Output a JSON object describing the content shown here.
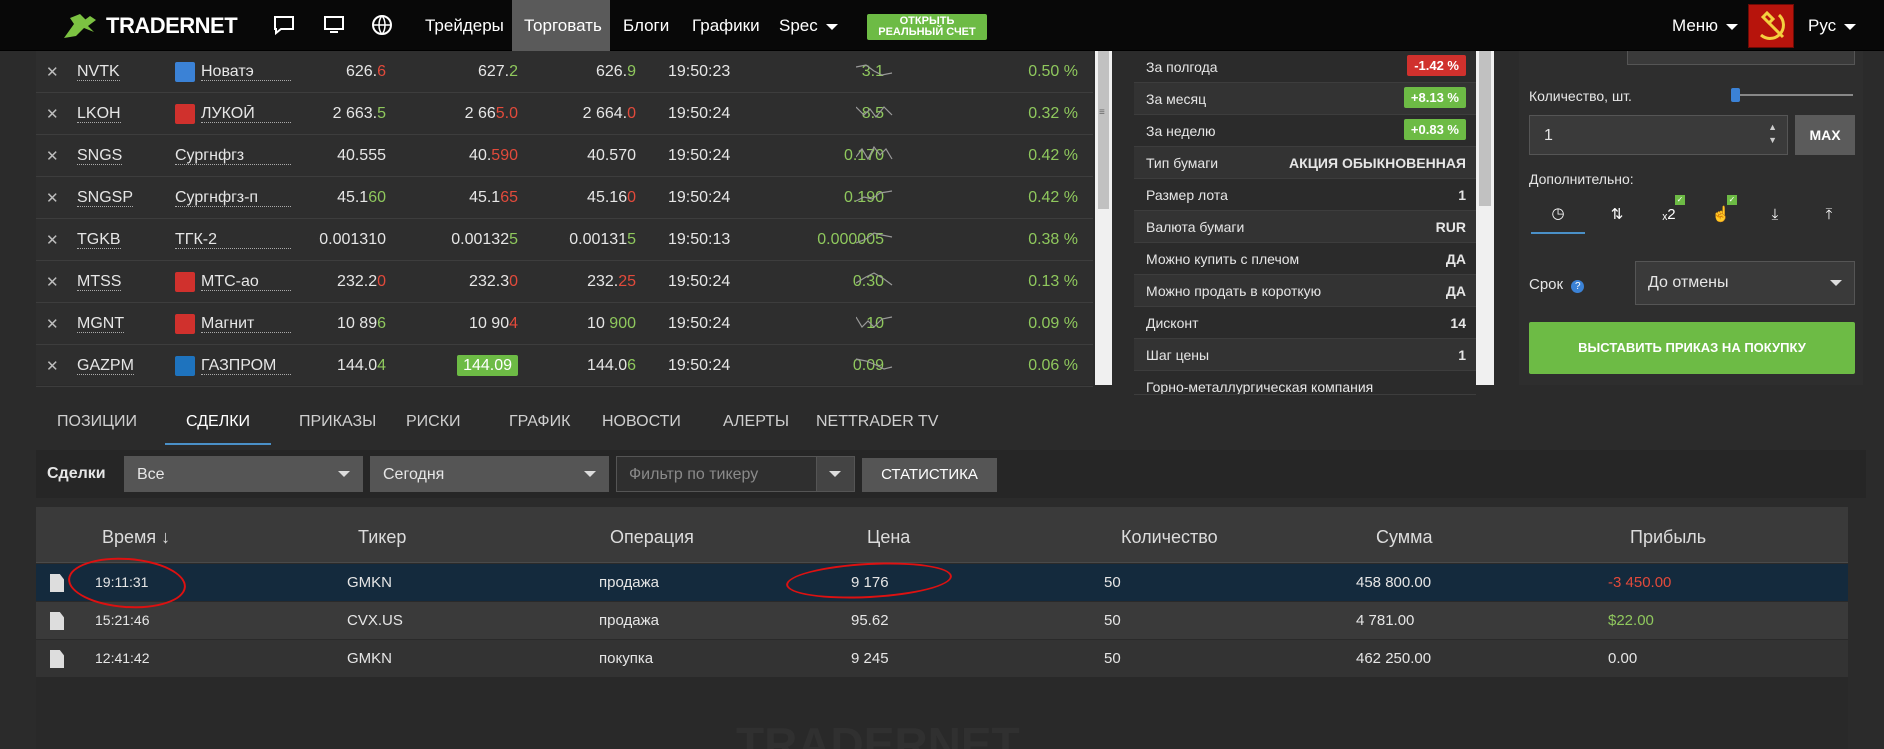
{
  "topbar": {
    "brand": "TRADERNET",
    "nav": [
      "Трейдеры",
      "Торговать",
      "Блоги",
      "Графики",
      "Spec"
    ],
    "open_account": [
      "ОТКРЫТЬ",
      "РЕАЛЬНЫЙ СЧЕТ"
    ],
    "menu": "Меню",
    "lang": "Рус",
    "accent": "#6dbb45"
  },
  "watchlist": [
    {
      "ticker": "NVTK",
      "name": "Новатэ",
      "p1": [
        "626.",
        "6"
      ],
      "p1c": "red",
      "p2": [
        "627.",
        "2"
      ],
      "p2c": "grn",
      "p3": [
        "626.",
        "9"
      ],
      "p3c": "grn",
      "time": "19:50:23",
      "chg": "3.1",
      "pct": "0.50 %"
    },
    {
      "ticker": "LKOH",
      "name": "ЛУКОЙ",
      "p1": [
        "2 663.",
        "5"
      ],
      "p1c": "grn",
      "p2": [
        "2 66",
        "5.0"
      ],
      "p2c": "red",
      "p3": [
        "2 664.",
        "0"
      ],
      "p3c": "red",
      "time": "19:50:24",
      "chg": "8.5",
      "pct": "0.32 %"
    },
    {
      "ticker": "SNGS",
      "name": "Сургнфгз",
      "p1": [
        "40.555",
        ""
      ],
      "p1c": "grn",
      "p2": [
        "40.",
        "590"
      ],
      "p2c": "red",
      "p3": [
        "40.570",
        ""
      ],
      "p3c": "grn",
      "time": "19:50:24",
      "chg": "0.170",
      "pct": "0.42 %"
    },
    {
      "ticker": "SNGSP",
      "name": "Сургнфгз-п",
      "p1": [
        "45.1",
        "60"
      ],
      "p1c": "grn",
      "p2": [
        "45.1",
        "65"
      ],
      "p2c": "red",
      "p3": [
        "45.16",
        "0"
      ],
      "p3c": "red",
      "time": "19:50:24",
      "chg": "0.190",
      "pct": "0.42 %"
    },
    {
      "ticker": "TGKB",
      "name": "ТГК-2",
      "p1": [
        "0.001310",
        ""
      ],
      "p1c": "grn",
      "p2": [
        "0.00132",
        "5"
      ],
      "p2c": "grn",
      "p3": [
        "0.00131",
        "5"
      ],
      "p3c": "grn",
      "time": "19:50:13",
      "chg": "0.000005",
      "pct": "0.38 %"
    },
    {
      "ticker": "MTSS",
      "name": "МТС-ао",
      "p1": [
        "232.2",
        "0"
      ],
      "p1c": "red",
      "p2": [
        "232.3",
        "0"
      ],
      "p2c": "red",
      "p3": [
        "232.",
        "25"
      ],
      "p3c": "red",
      "time": "19:50:24",
      "chg": "0.30",
      "pct": "0.13 %"
    },
    {
      "ticker": "MGNT",
      "name": "Магнит",
      "p1": [
        "10 89",
        "6"
      ],
      "p1c": "grn",
      "p2": [
        "10 90",
        "4"
      ],
      "p2c": "red",
      "p3": [
        "10 ",
        "900"
      ],
      "p3c": "grn",
      "time": "19:50:24",
      "chg": "10",
      "pct": "0.09 %"
    },
    {
      "ticker": "GAZPM",
      "name": "ГАЗПРОМ",
      "p1": [
        "144.0",
        "4"
      ],
      "p1c": "grn",
      "p2": [
        "144.09",
        ""
      ],
      "p2c": "hl",
      "p3": [
        "144.0",
        "6"
      ],
      "p3c": "grn",
      "time": "19:50:24",
      "chg": "0.09",
      "pct": "0.06 %"
    }
  ],
  "info": [
    {
      "label": "За полгода",
      "value": "-1.42 %",
      "badge": "#d0312d"
    },
    {
      "label": "За месяц",
      "value": "+8.13 %",
      "badge": "#6dbb45"
    },
    {
      "label": "За неделю",
      "value": "+0.83 %",
      "badge": "#6dbb45"
    },
    {
      "label": "Тип бумаги",
      "value": "АКЦИЯ ОБЫКНОВЕННАЯ"
    },
    {
      "label": "Размер лота",
      "value": "1"
    },
    {
      "label": "Валюта бумаги",
      "value": "RUR"
    },
    {
      "label": "Можно купить с плечом",
      "value": "ДА"
    },
    {
      "label": "Можно продать в короткую",
      "value": "ДА"
    },
    {
      "label": "Дисконт",
      "value": "14"
    },
    {
      "label": "Шаг цены",
      "value": "1"
    },
    {
      "label": "Горно-металлургическая компания",
      "value": ""
    }
  ],
  "order": {
    "qty_label": "Количество, шт.",
    "qty_value": "1",
    "max": "MAX",
    "extra_label": "Дополнительно:",
    "term_label": "Срок",
    "term_value": "До отмены",
    "buy": "ВЫСТАВИТЬ ПРИКАЗ НА ПОКУПКУ"
  },
  "tabs": [
    "ПОЗИЦИИ",
    "СДЕЛКИ",
    "ПРИКАЗЫ",
    "РИСКИ",
    "ГРАФИК",
    "НОВОСТИ",
    "АЛЕРТЫ",
    "NETTRADER TV"
  ],
  "filters": {
    "label": "Сделки",
    "type": "Все",
    "period": "Сегодня",
    "ticker_placeholder": "Фильтр по тикеру",
    "stats": "СТАТИСТИКА"
  },
  "trades": {
    "columns": [
      "Время ↓",
      "Тикер",
      "Операция",
      "Цена",
      "Количество",
      "Сумма",
      "Прибыль"
    ],
    "rows": [
      {
        "time": "19:11:31",
        "ticker": "GMKN",
        "op": "продажа",
        "price": "9 176",
        "qty": "50",
        "sum": "458 800.00",
        "profit": "-3 450.00",
        "pc": "red"
      },
      {
        "time": "15:21:46",
        "ticker": "CVX.US",
        "op": "продажа",
        "price": "95.62",
        "qty": "50",
        "sum": "4 781.00",
        "profit": "$22.00",
        "pc": "grn"
      },
      {
        "time": "12:41:42",
        "ticker": "GMKN",
        "op": "покупка",
        "price": "9 245",
        "qty": "50",
        "sum": "462 250.00",
        "profit": "0.00",
        "pc": ""
      }
    ]
  }
}
